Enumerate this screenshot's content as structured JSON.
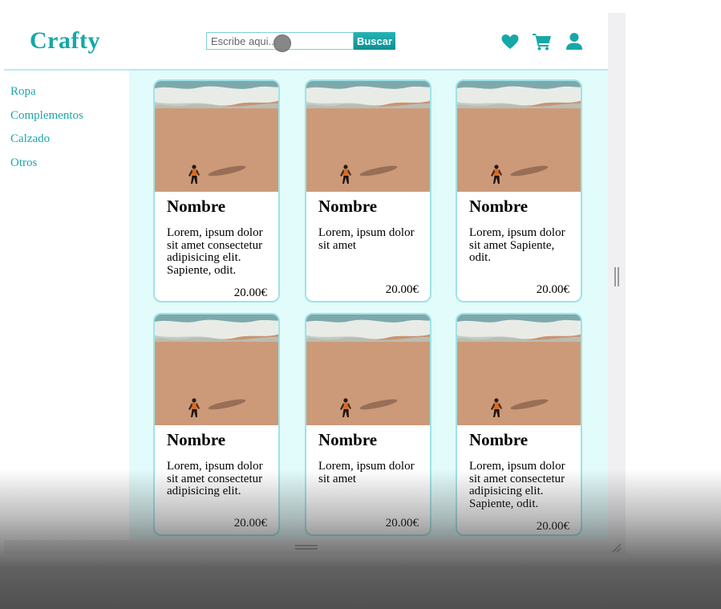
{
  "header": {
    "logo": "Crafty",
    "search_placeholder": "Escribe aqui...",
    "search_button": "Buscar",
    "icons": [
      "heart-icon",
      "cart-icon",
      "user-icon"
    ]
  },
  "sidebar": {
    "items": [
      {
        "label": "Ropa"
      },
      {
        "label": "Complementos"
      },
      {
        "label": "Calzado"
      },
      {
        "label": "Otros"
      }
    ]
  },
  "products": [
    {
      "name": "Nombre",
      "description": "Lorem, ipsum dolor sit amet consectetur adipisicing elit. Sapiente, odit.",
      "price": "20.00€"
    },
    {
      "name": "Nombre",
      "description": "Lorem, ipsum dolor sit amet",
      "price": "20.00€"
    },
    {
      "name": "Nombre",
      "description": "Lorem, ipsum dolor sit amet Sapiente, odit.",
      "price": "20.00€"
    },
    {
      "name": "Nombre",
      "description": "Lorem, ipsum dolor sit amet consectetur adipisicing elit.",
      "price": "20.00€"
    },
    {
      "name": "Nombre",
      "description": "Lorem, ipsum dolor sit amet",
      "price": "20.00€"
    },
    {
      "name": "Nombre",
      "description": "Lorem, ipsum dolor sit amet consectetur adipisicing elit. Sapiente, odit.",
      "price": "20.00€"
    }
  ],
  "colors": {
    "brand": "#14a8a8",
    "content_background": "#e2fbfb",
    "card_border": "#9fe3e6",
    "button": "#0e8f92"
  }
}
